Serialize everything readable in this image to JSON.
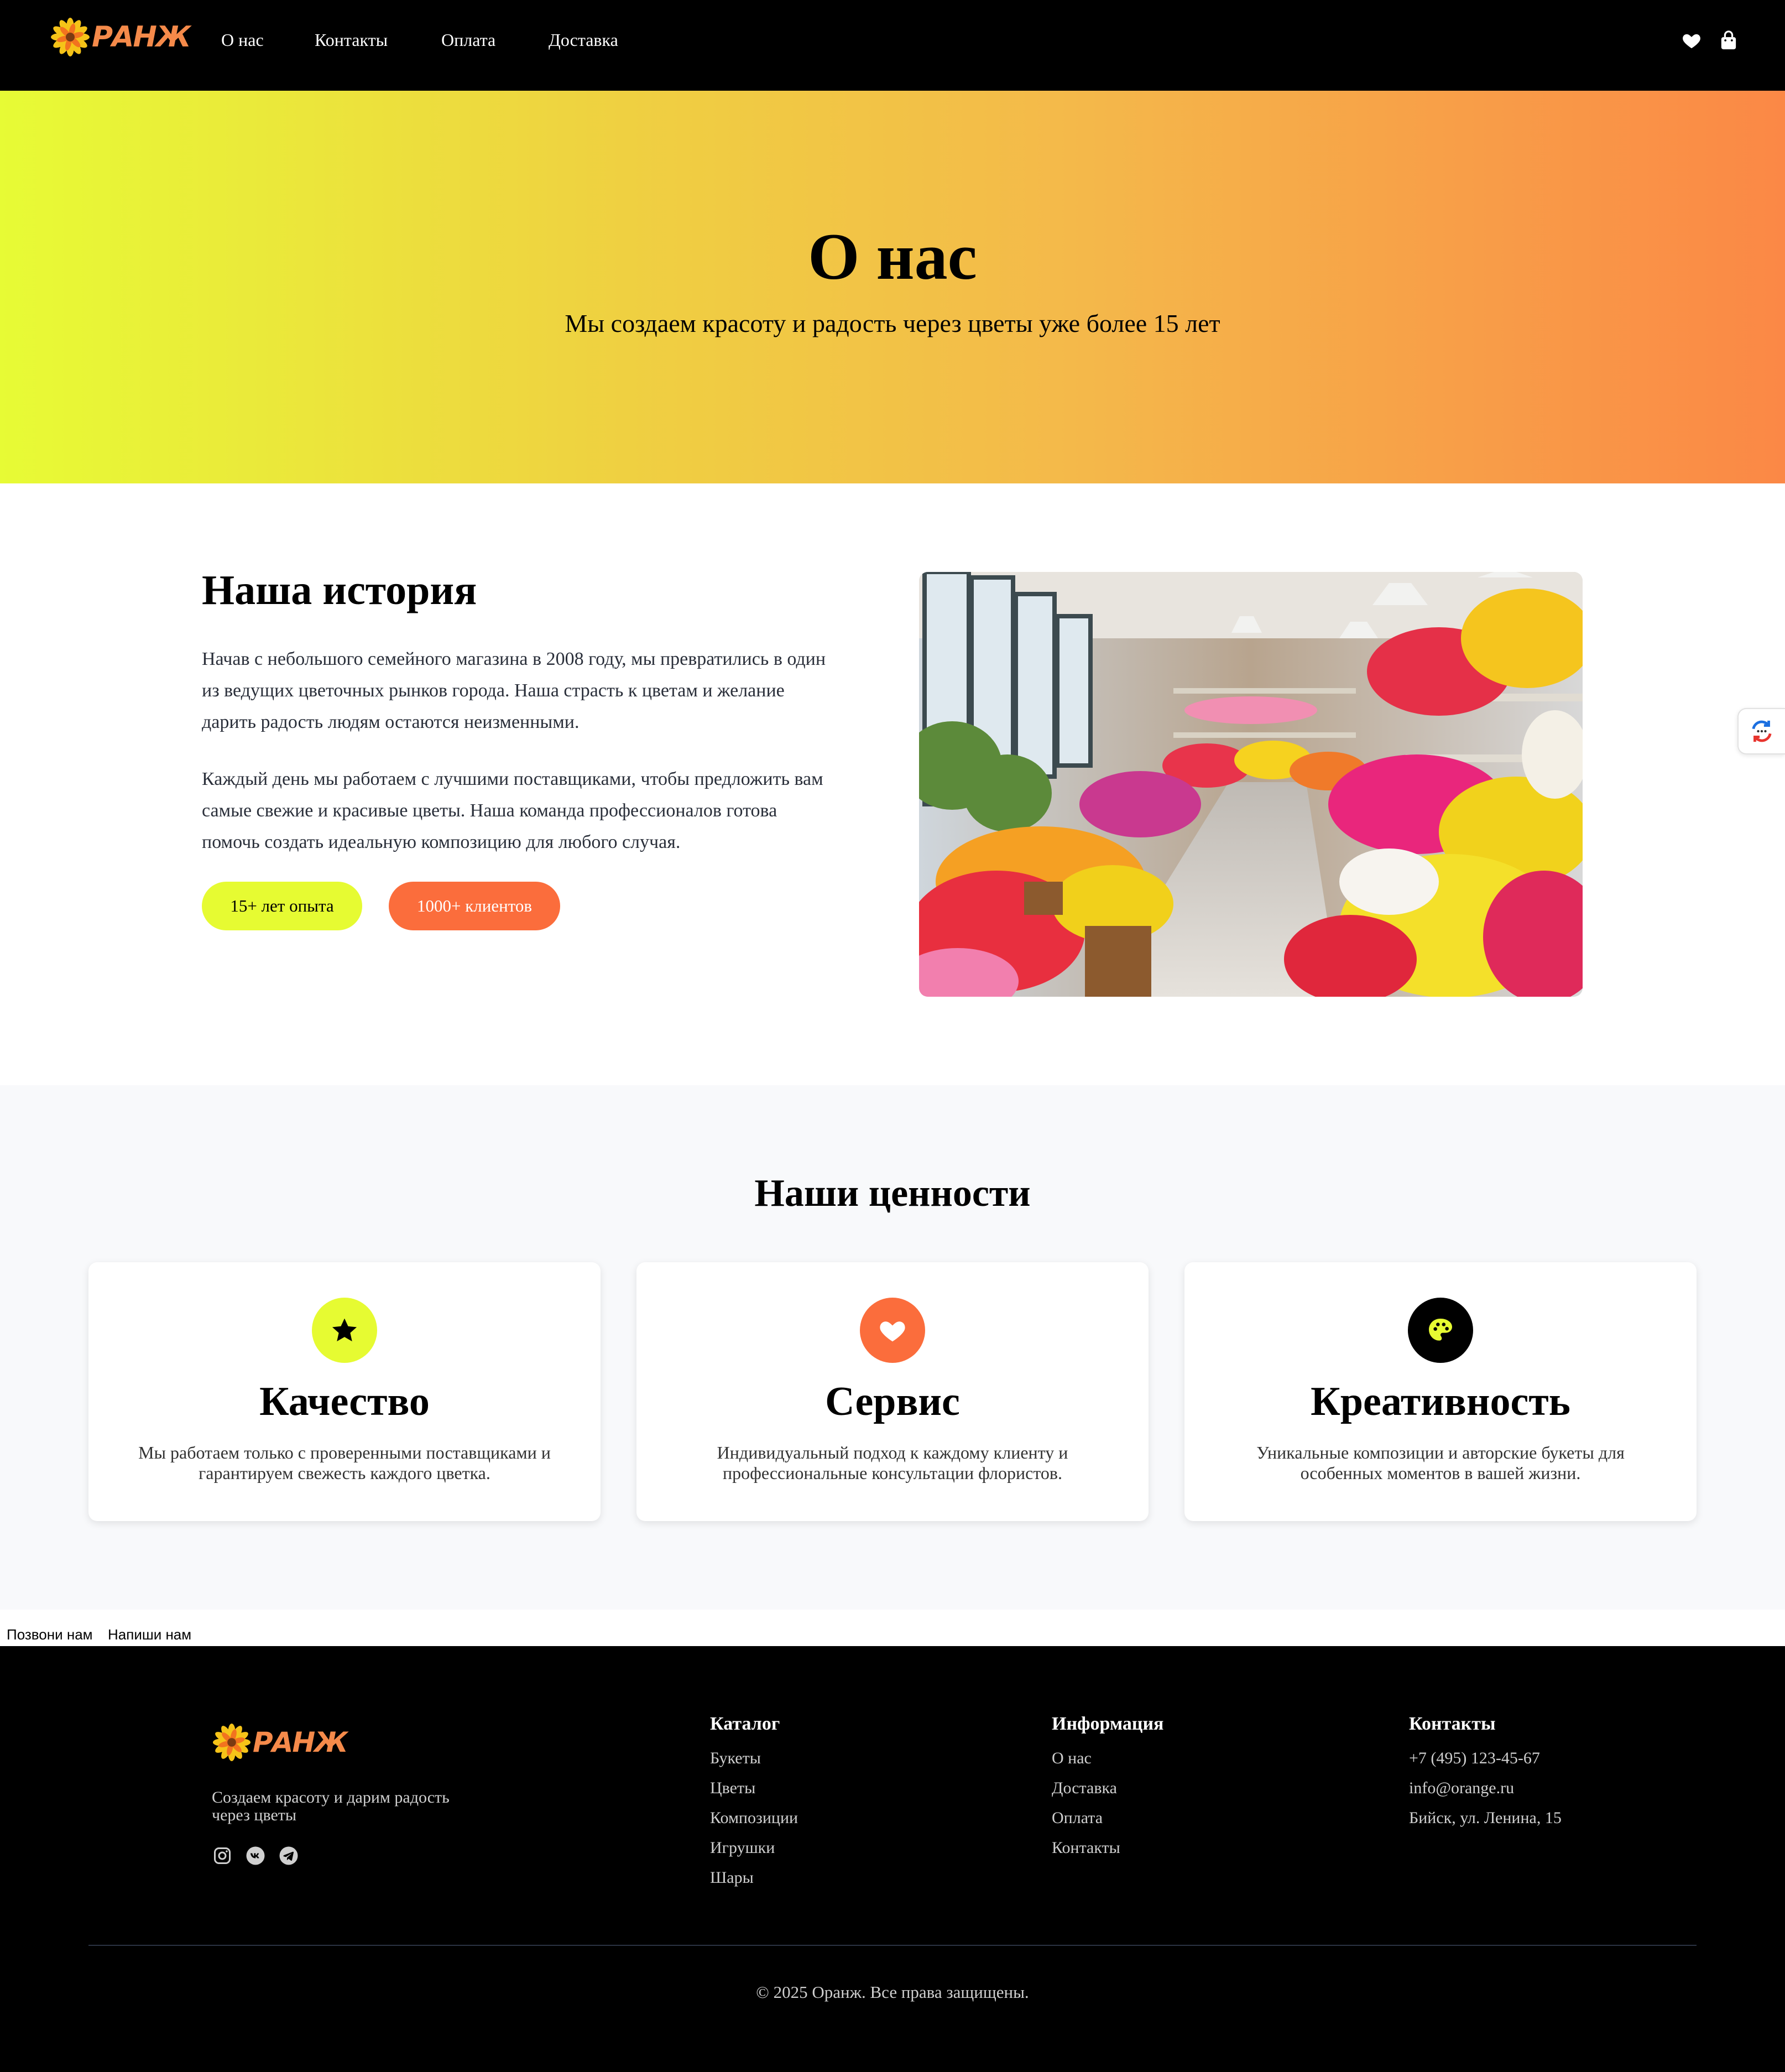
{
  "header": {
    "logo_text": "РАНЖ",
    "nav": [
      "О нас",
      "Контакты",
      "Оплата",
      "Доставка"
    ]
  },
  "hero": {
    "title": "О нас",
    "subtitle": "Мы создаем красоту и радость через цветы уже более 15 лет"
  },
  "history": {
    "title": "Наша история",
    "paragraphs": [
      [
        "Начав с небольшого семейного магазина в 2008 году, мы превратились в один",
        "из ведущих цветочных рынков города. Наша страсть к цветам и желание",
        "дарить радость людям остаются неизменными."
      ],
      [
        "Каждый день мы работаем с лучшими поставщиками, чтобы предложить вам",
        "самые свежие и красивые цветы. Наша команда профессионалов готова",
        "помочь создать идеальную композицию для любого случая."
      ]
    ],
    "badge_experience": "15+ лет опыта",
    "badge_clients": "1000+ клиентов"
  },
  "values": {
    "title": "Наши ценности",
    "cards": [
      {
        "title": "Качество",
        "text": [
          "Мы работаем только с проверенными поставщиками и",
          "гарантируем свежесть каждого цветка."
        ],
        "icon": "star-icon"
      },
      {
        "title": "Сервис",
        "text": [
          "Индивидуальный подход к каждому клиенту и",
          "профессиональные консультации флористов."
        ],
        "icon": "heart-icon"
      },
      {
        "title": "Креативность",
        "text": [
          "Уникальные композиции и авторские букеты для",
          "особенных моментов в вашей жизни."
        ],
        "icon": "palette-icon"
      }
    ]
  },
  "callbar": {
    "call": "Позвони нам",
    "write": "Напиши нам"
  },
  "footer": {
    "logo_text": "РАНЖ",
    "tagline": [
      "Создаем красоту и дарим радость",
      "через цветы"
    ],
    "catalog": {
      "title": "Каталог",
      "items": [
        "Букеты",
        "Цветы",
        "Композиции",
        "Игрушки",
        "Шары"
      ]
    },
    "info": {
      "title": "Информация",
      "items": [
        "О нас",
        "Доставка",
        "Оплата",
        "Контакты"
      ]
    },
    "contacts": {
      "title": "Контакты",
      "items": [
        "+7 (495) 123-45-67",
        "info@orange.ru",
        "Бийск, ул. Ленина, 15"
      ]
    },
    "copyright": "© 2025 Оранж. Все права защищены."
  },
  "colors": {
    "accent_yellow": "#e6fb32",
    "accent_orange": "#fb6d3c",
    "logo_orange": "#f58a4a"
  }
}
